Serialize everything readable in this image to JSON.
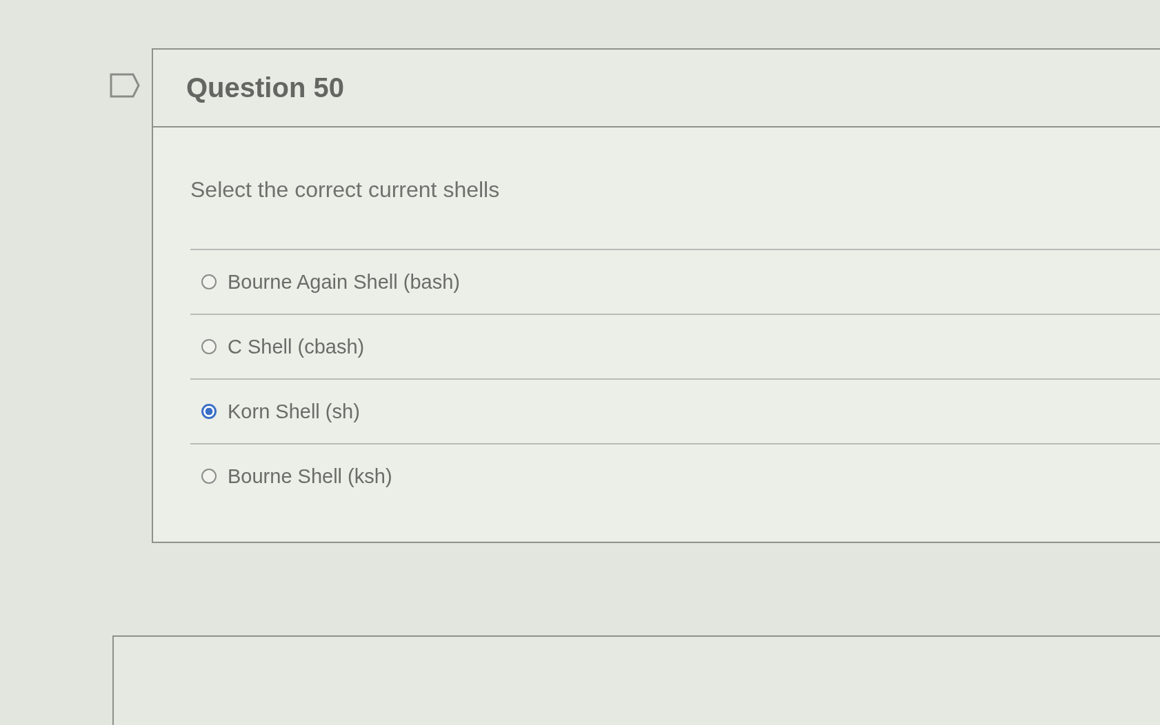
{
  "question": {
    "title": "Question 50",
    "prompt": "Select the correct current shells",
    "options": [
      {
        "label": "Bourne Again Shell (bash)",
        "selected": false
      },
      {
        "label": "C Shell (cbash)",
        "selected": false
      },
      {
        "label": "Korn Shell (sh)",
        "selected": true
      },
      {
        "label": "Bourne Shell (ksh)",
        "selected": false
      }
    ]
  }
}
